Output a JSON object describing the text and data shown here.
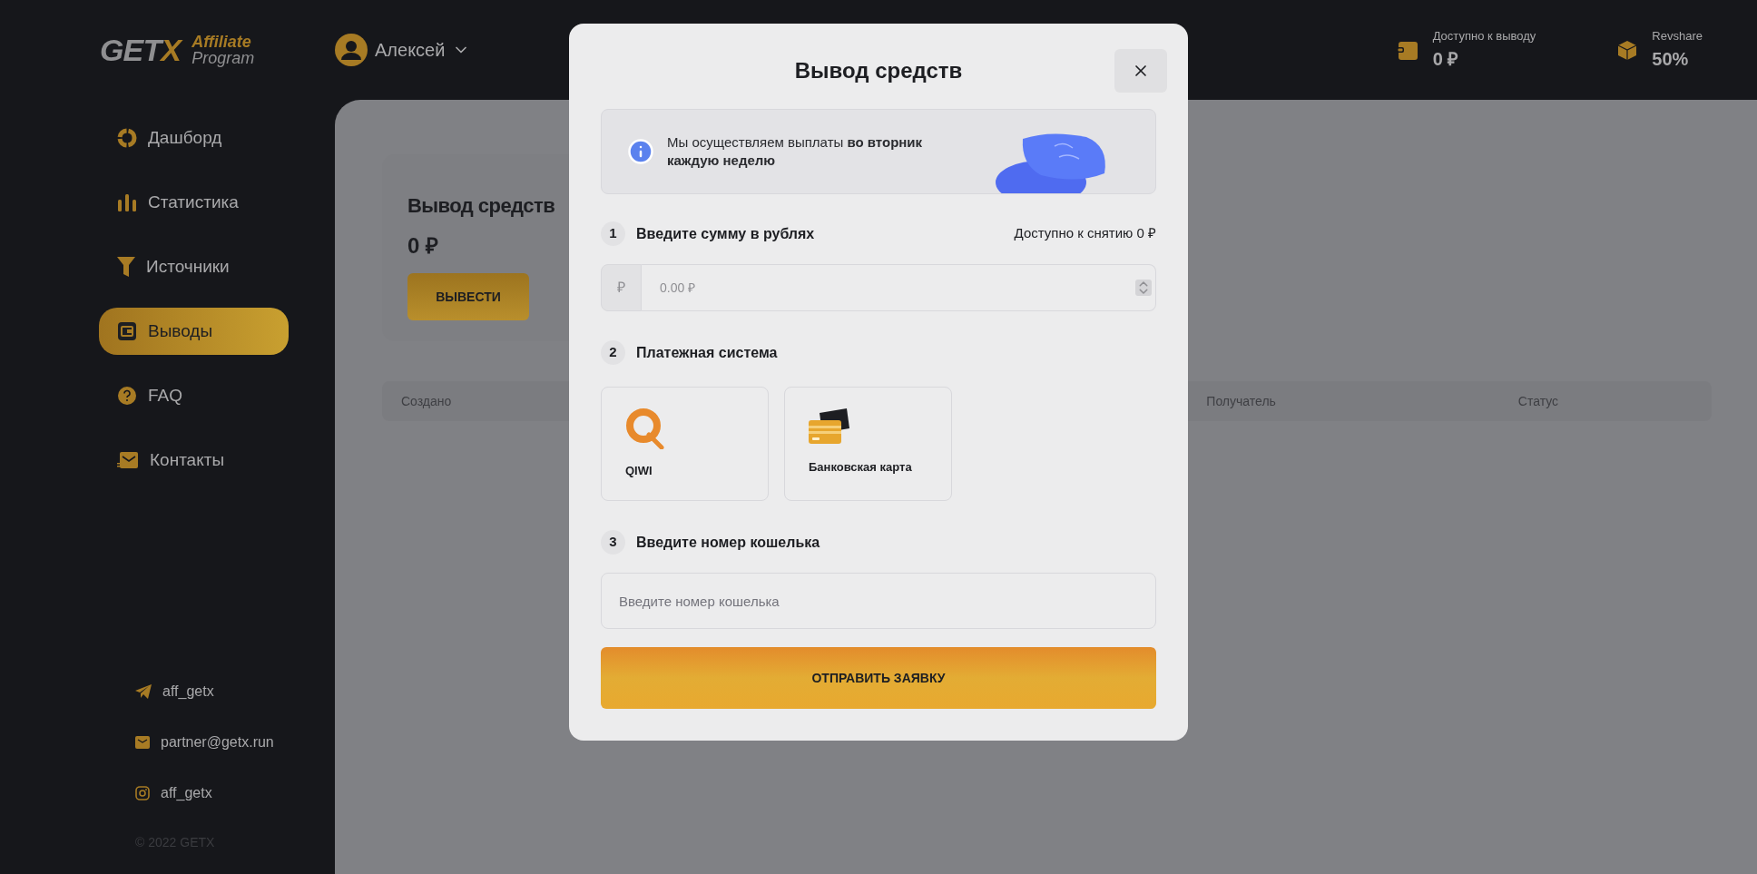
{
  "header": {
    "logo": {
      "word": "GET",
      "mark": "X",
      "line1": "Affiliate",
      "line2": "Program"
    },
    "user": {
      "name": "Алексей"
    },
    "stats": [
      {
        "kind": "wallet",
        "label": "Доступно к выводу",
        "value": "0 ₽"
      },
      {
        "kind": "box",
        "label": "Revshare",
        "value": "50%"
      }
    ]
  },
  "sidebar": {
    "items": [
      {
        "kind": "dashboard",
        "label": "Дашборд",
        "selected": false
      },
      {
        "kind": "statistics",
        "label": "Статистика",
        "selected": false
      },
      {
        "kind": "sources",
        "label": "Источники",
        "selected": false
      },
      {
        "kind": "payouts",
        "label": "Выводы",
        "selected": true
      },
      {
        "kind": "faq",
        "label": "FAQ",
        "selected": false
      },
      {
        "kind": "contacts",
        "label": "Контакты",
        "selected": false
      }
    ],
    "contacts": [
      {
        "kind": "telegram",
        "text": "aff_getx"
      },
      {
        "kind": "mail",
        "text": "partner@getx.run"
      },
      {
        "kind": "instagram",
        "text": "aff_getx"
      }
    ],
    "copyright": "© 2022 GETX"
  },
  "page": {
    "title": "Вывод средств",
    "amount": "0 ₽",
    "button": "ВЫВЕСТИ",
    "table": {
      "columns": [
        "Создано",
        "Получатель",
        "Статус"
      ]
    }
  },
  "modal": {
    "title": "Вывод средств",
    "info": "Мы осуществляем выплаты **во вторник каждую неделю**",
    "step_amount": {
      "number": "1",
      "title": "Введите сумму в рублях",
      "aside": "Доступно к снятию 0 ₽",
      "prefix": "₽",
      "placeholder": "0.00 ₽"
    },
    "step_payment": {
      "number": "2",
      "title": "Платежная система",
      "options": [
        {
          "kind": "qiwi",
          "label": "QIWI",
          "selected": false
        },
        {
          "kind": "card",
          "label": "Банковская карта",
          "selected": false
        }
      ]
    },
    "step_wallet": {
      "number": "3",
      "title": "Введите номер кошелька",
      "placeholder": "Введите номер кошелька"
    },
    "submit": "ОТПРАВИТЬ ЗАЯВКУ"
  }
}
